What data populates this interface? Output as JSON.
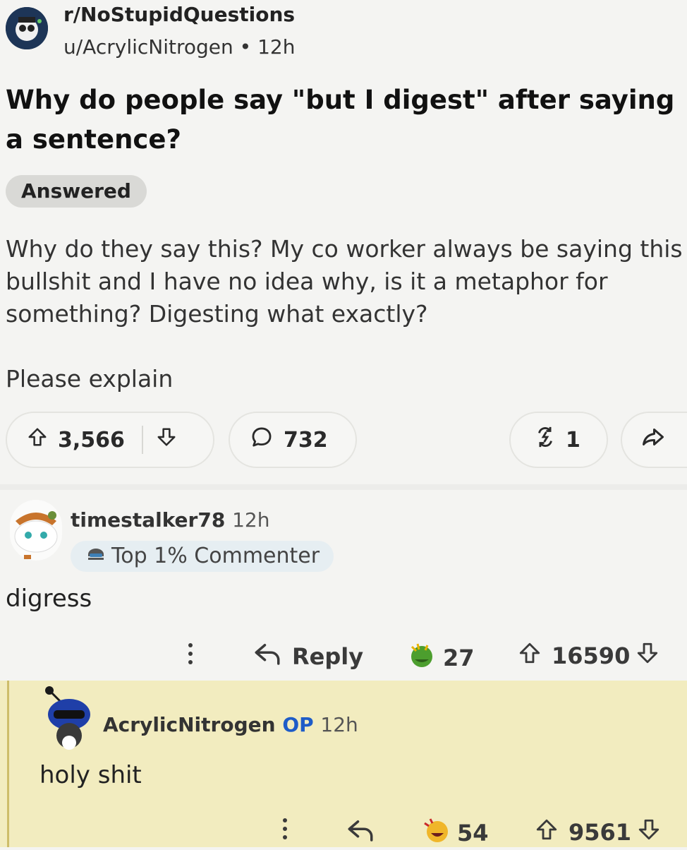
{
  "post": {
    "subreddit": "r/NoStupidQuestions",
    "author": "u/AcrylicNitrogen",
    "age": "12h",
    "title": "Why do people say \"but I digest\" after saying a sentence?",
    "flair": "Answered",
    "body": "Why do they say this? My co worker always be saying this bullshit and I have no idea why, is it a metaphor for something? Digesting what exactly?",
    "body2": "Please explain",
    "upvotes": "3,566",
    "comments": "732",
    "awards": "1"
  },
  "comments": [
    {
      "author": "timestalker78",
      "age": "12h",
      "badge": "Top 1% Commenter",
      "text": "digress",
      "reply_label": "Reply",
      "award_count": "27",
      "score": "16590"
    },
    {
      "author": "AcrylicNitrogen",
      "op_tag": "OP",
      "age": "12h",
      "text": "holy shit",
      "award_count": "54",
      "score": "9561"
    }
  ],
  "colors": {
    "background": "#f4f4f2",
    "highlight": "#f2ecbf",
    "op_blue": "#1e5cc8",
    "award_green": "#3f8f2c"
  }
}
